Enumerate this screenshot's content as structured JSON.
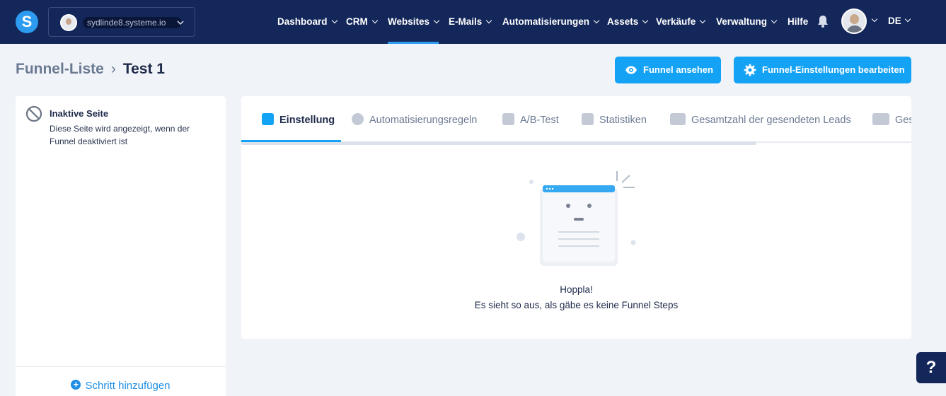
{
  "app": {
    "logo_letter": "S"
  },
  "account": {
    "name": "sydlinde8.systeme.io"
  },
  "nav": {
    "items": [
      {
        "label": "Dashboard"
      },
      {
        "label": "CRM"
      },
      {
        "label": "Websites"
      },
      {
        "label": "E-Mails"
      },
      {
        "label": "Automatisierungen"
      },
      {
        "label": "Assets"
      },
      {
        "label": "Verkäufe"
      },
      {
        "label": "Verwaltung"
      },
      {
        "label": "Hilfe"
      }
    ],
    "active": "Websites",
    "language": "DE"
  },
  "breadcrumb": {
    "parent": "Funnel-Liste",
    "current": "Test 1"
  },
  "actions": {
    "view_funnel": "Funnel ansehen",
    "edit_settings": "Funnel-Einstellungen bearbeiten"
  },
  "sidebar": {
    "inactive_title": "Inaktive Seite",
    "inactive_desc": "Diese Seite wird angezeigt, wenn der Funnel deaktiviert ist",
    "add_step": "Schritt hinzufügen"
  },
  "tabs": [
    {
      "label": "Einstellung",
      "icon": "sliders-icon",
      "active": true
    },
    {
      "label": "Automatisierungsregeln",
      "icon": "bolt-icon",
      "active": false
    },
    {
      "label": "A/B-Test",
      "icon": "split-icon",
      "active": false
    },
    {
      "label": "Statistiken",
      "icon": "bar-chart-icon",
      "active": false
    },
    {
      "label": "Gesamtzahl der gesendeten Leads",
      "icon": "users-icon",
      "active": false
    },
    {
      "label": "Ges",
      "icon": "dollar-icon",
      "active": false
    }
  ],
  "empty_state": {
    "title": "Hoppla!",
    "subtitle": "Es sieht so aus, als gäbe es keine Funnel Steps"
  },
  "help": {
    "label": "?"
  },
  "colors": {
    "nav_bg": "#13275a",
    "accent": "#14a2f5",
    "page_bg": "#f0f3f7"
  }
}
